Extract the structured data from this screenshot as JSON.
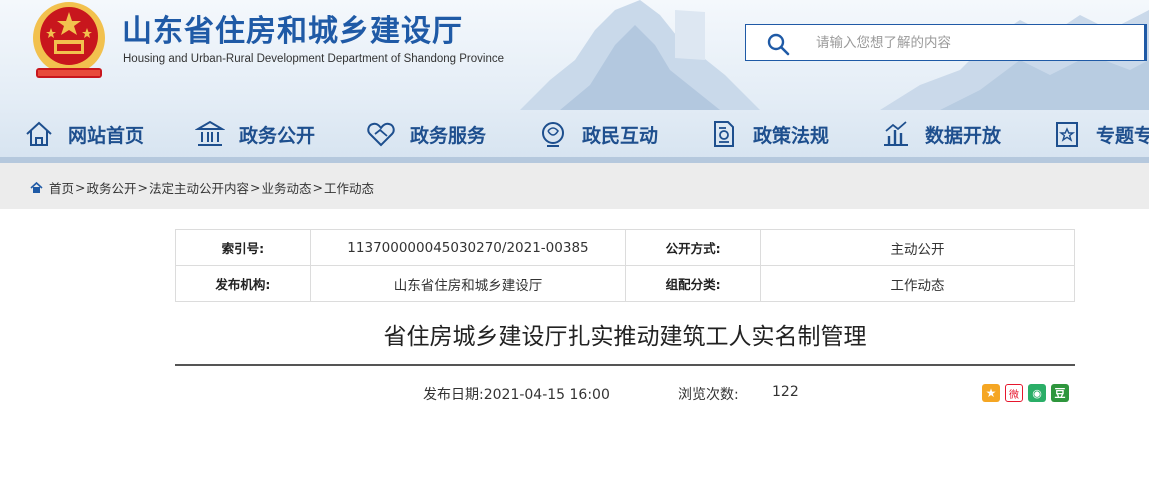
{
  "header": {
    "title": "山东省住房和城乡建设厅",
    "subtitle": "Housing and Urban-Rural Development Department of Shandong Province",
    "search_placeholder": "请输入您想了解的内容"
  },
  "nav": [
    {
      "label": "网站首页",
      "icon": "home-icon"
    },
    {
      "label": "政务公开",
      "icon": "government-building-icon"
    },
    {
      "label": "政务服务",
      "icon": "handshake-icon"
    },
    {
      "label": "政民互动",
      "icon": "chat-icon"
    },
    {
      "label": "政策法规",
      "icon": "document-icon"
    },
    {
      "label": "数据开放",
      "icon": "bar-chart-icon"
    },
    {
      "label": "专题专",
      "icon": "bookmark-icon"
    }
  ],
  "breadcrumb": [
    "首页",
    "政务公开",
    "法定主动公开内容",
    "业务动态",
    "工作动态"
  ],
  "info": {
    "index_label": "索引号:",
    "index_value": "113700000045030270/2021-00385",
    "open_label": "公开方式:",
    "open_value": "主动公开",
    "org_label": "发布机构:",
    "org_value": "山东省住房和城乡建设厅",
    "category_label": "组配分类:",
    "category_value": "工作动态"
  },
  "article": {
    "title": "省住房城乡建设厅扎实推动建筑工人实名制管理",
    "publish": "发布日期:2021-04-15 16:00",
    "views_label": "浏览次数:",
    "views": "122"
  },
  "share": [
    {
      "icon": "qzone-icon",
      "color": "#f5a623",
      "glyph": "★"
    },
    {
      "icon": "weibo-icon",
      "color": "#e6162d",
      "glyph": "微"
    },
    {
      "icon": "wechat-icon",
      "color": "#2aae67",
      "glyph": "◉"
    },
    {
      "icon": "douban-icon",
      "color": "#2e963d",
      "glyph": "豆"
    }
  ],
  "colors": {
    "brand": "#1f5aa6",
    "nav_text": "#1e4f8e",
    "emblem_red": "#c8161d",
    "emblem_gold": "#f2c14e"
  }
}
